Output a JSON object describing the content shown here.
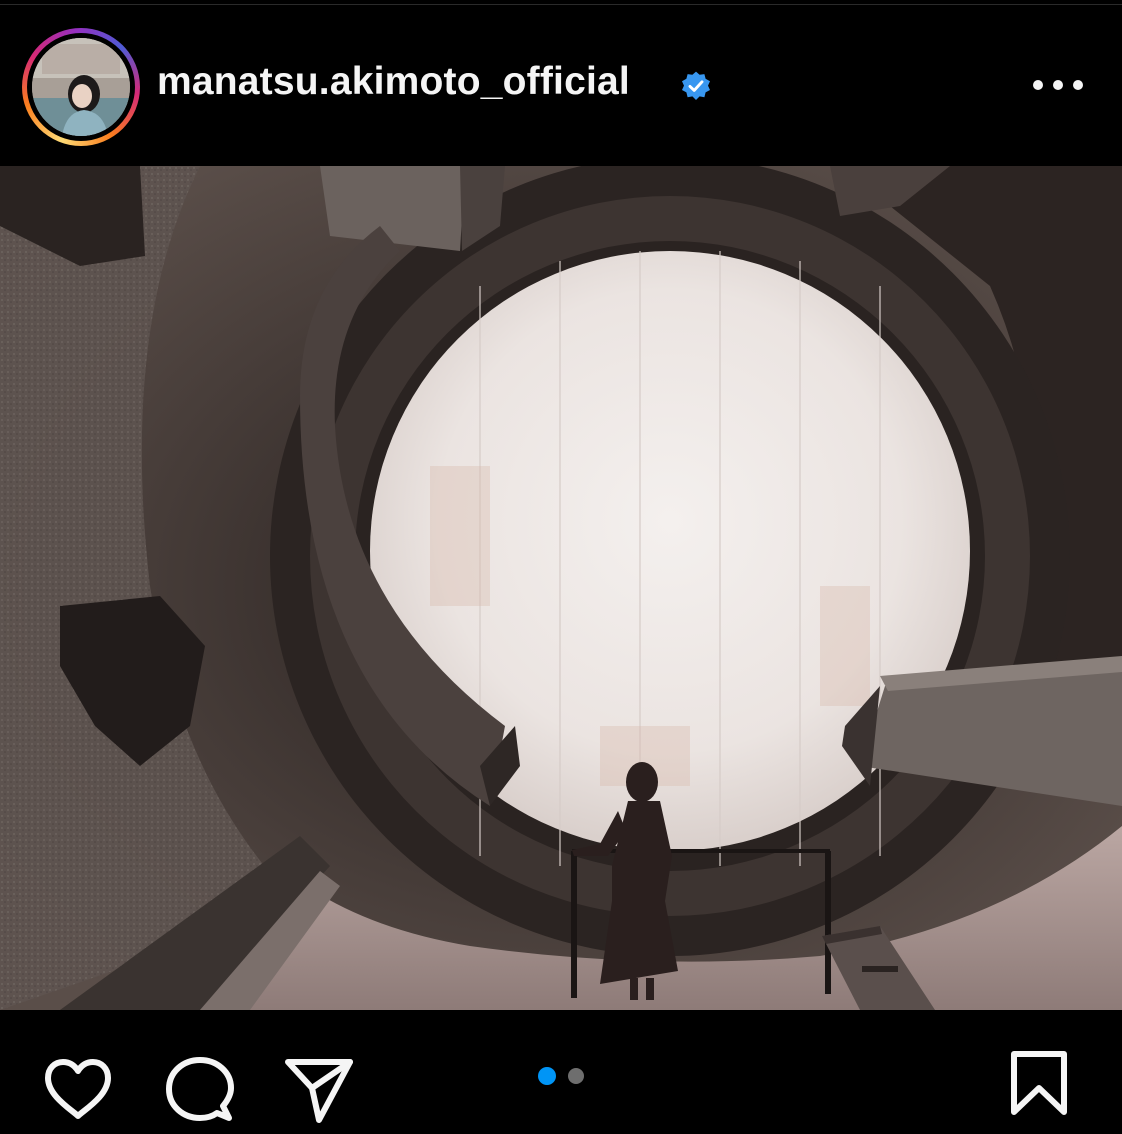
{
  "post": {
    "username": "manatsu.akimoto_official",
    "verified": true,
    "avatar_icon": "profile-photo",
    "more_icon": "more-horizontal-icon",
    "image_alt": ""
  },
  "carousel": {
    "total": 2,
    "active_index": 0,
    "active_color": "#0095f6",
    "inactive_color": "#6e6e6e"
  },
  "actions": {
    "like_icon": "heart-icon",
    "comment_icon": "comment-icon",
    "share_icon": "send-icon",
    "save_icon": "bookmark-icon"
  },
  "colors": {
    "background": "#000000",
    "text": "#f5f5f5",
    "verified_badge": "#3897f0",
    "story_ring": [
      "#feda75",
      "#fa7e1e",
      "#d62976",
      "#962fbf",
      "#4f5bd5"
    ]
  }
}
